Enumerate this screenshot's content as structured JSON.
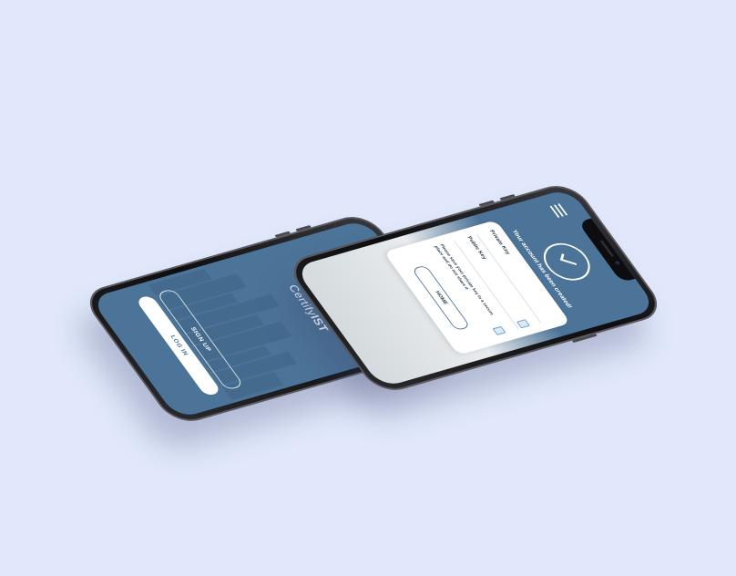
{
  "welcome_screen": {
    "brand_light": "Certify",
    "brand_bold": "IST",
    "signup_label": "SIGN UP",
    "login_label": "LOG IN",
    "logo_icon": "shield-logo-icon"
  },
  "success_screen": {
    "menu_icon": "menu-icon",
    "check_icon": "checkmark-icon",
    "message": "Your account has been created!",
    "private_key_label": "Private Key",
    "public_key_label": "Public Key",
    "save_note": "Please save your private key in a secure place and do not share it",
    "home_label": "HOME"
  },
  "colors": {
    "background": "#e1e8fb",
    "screen_blue": "#4c7498",
    "card_white": "#ffffff",
    "phone_frame": "#1a1a1d"
  }
}
